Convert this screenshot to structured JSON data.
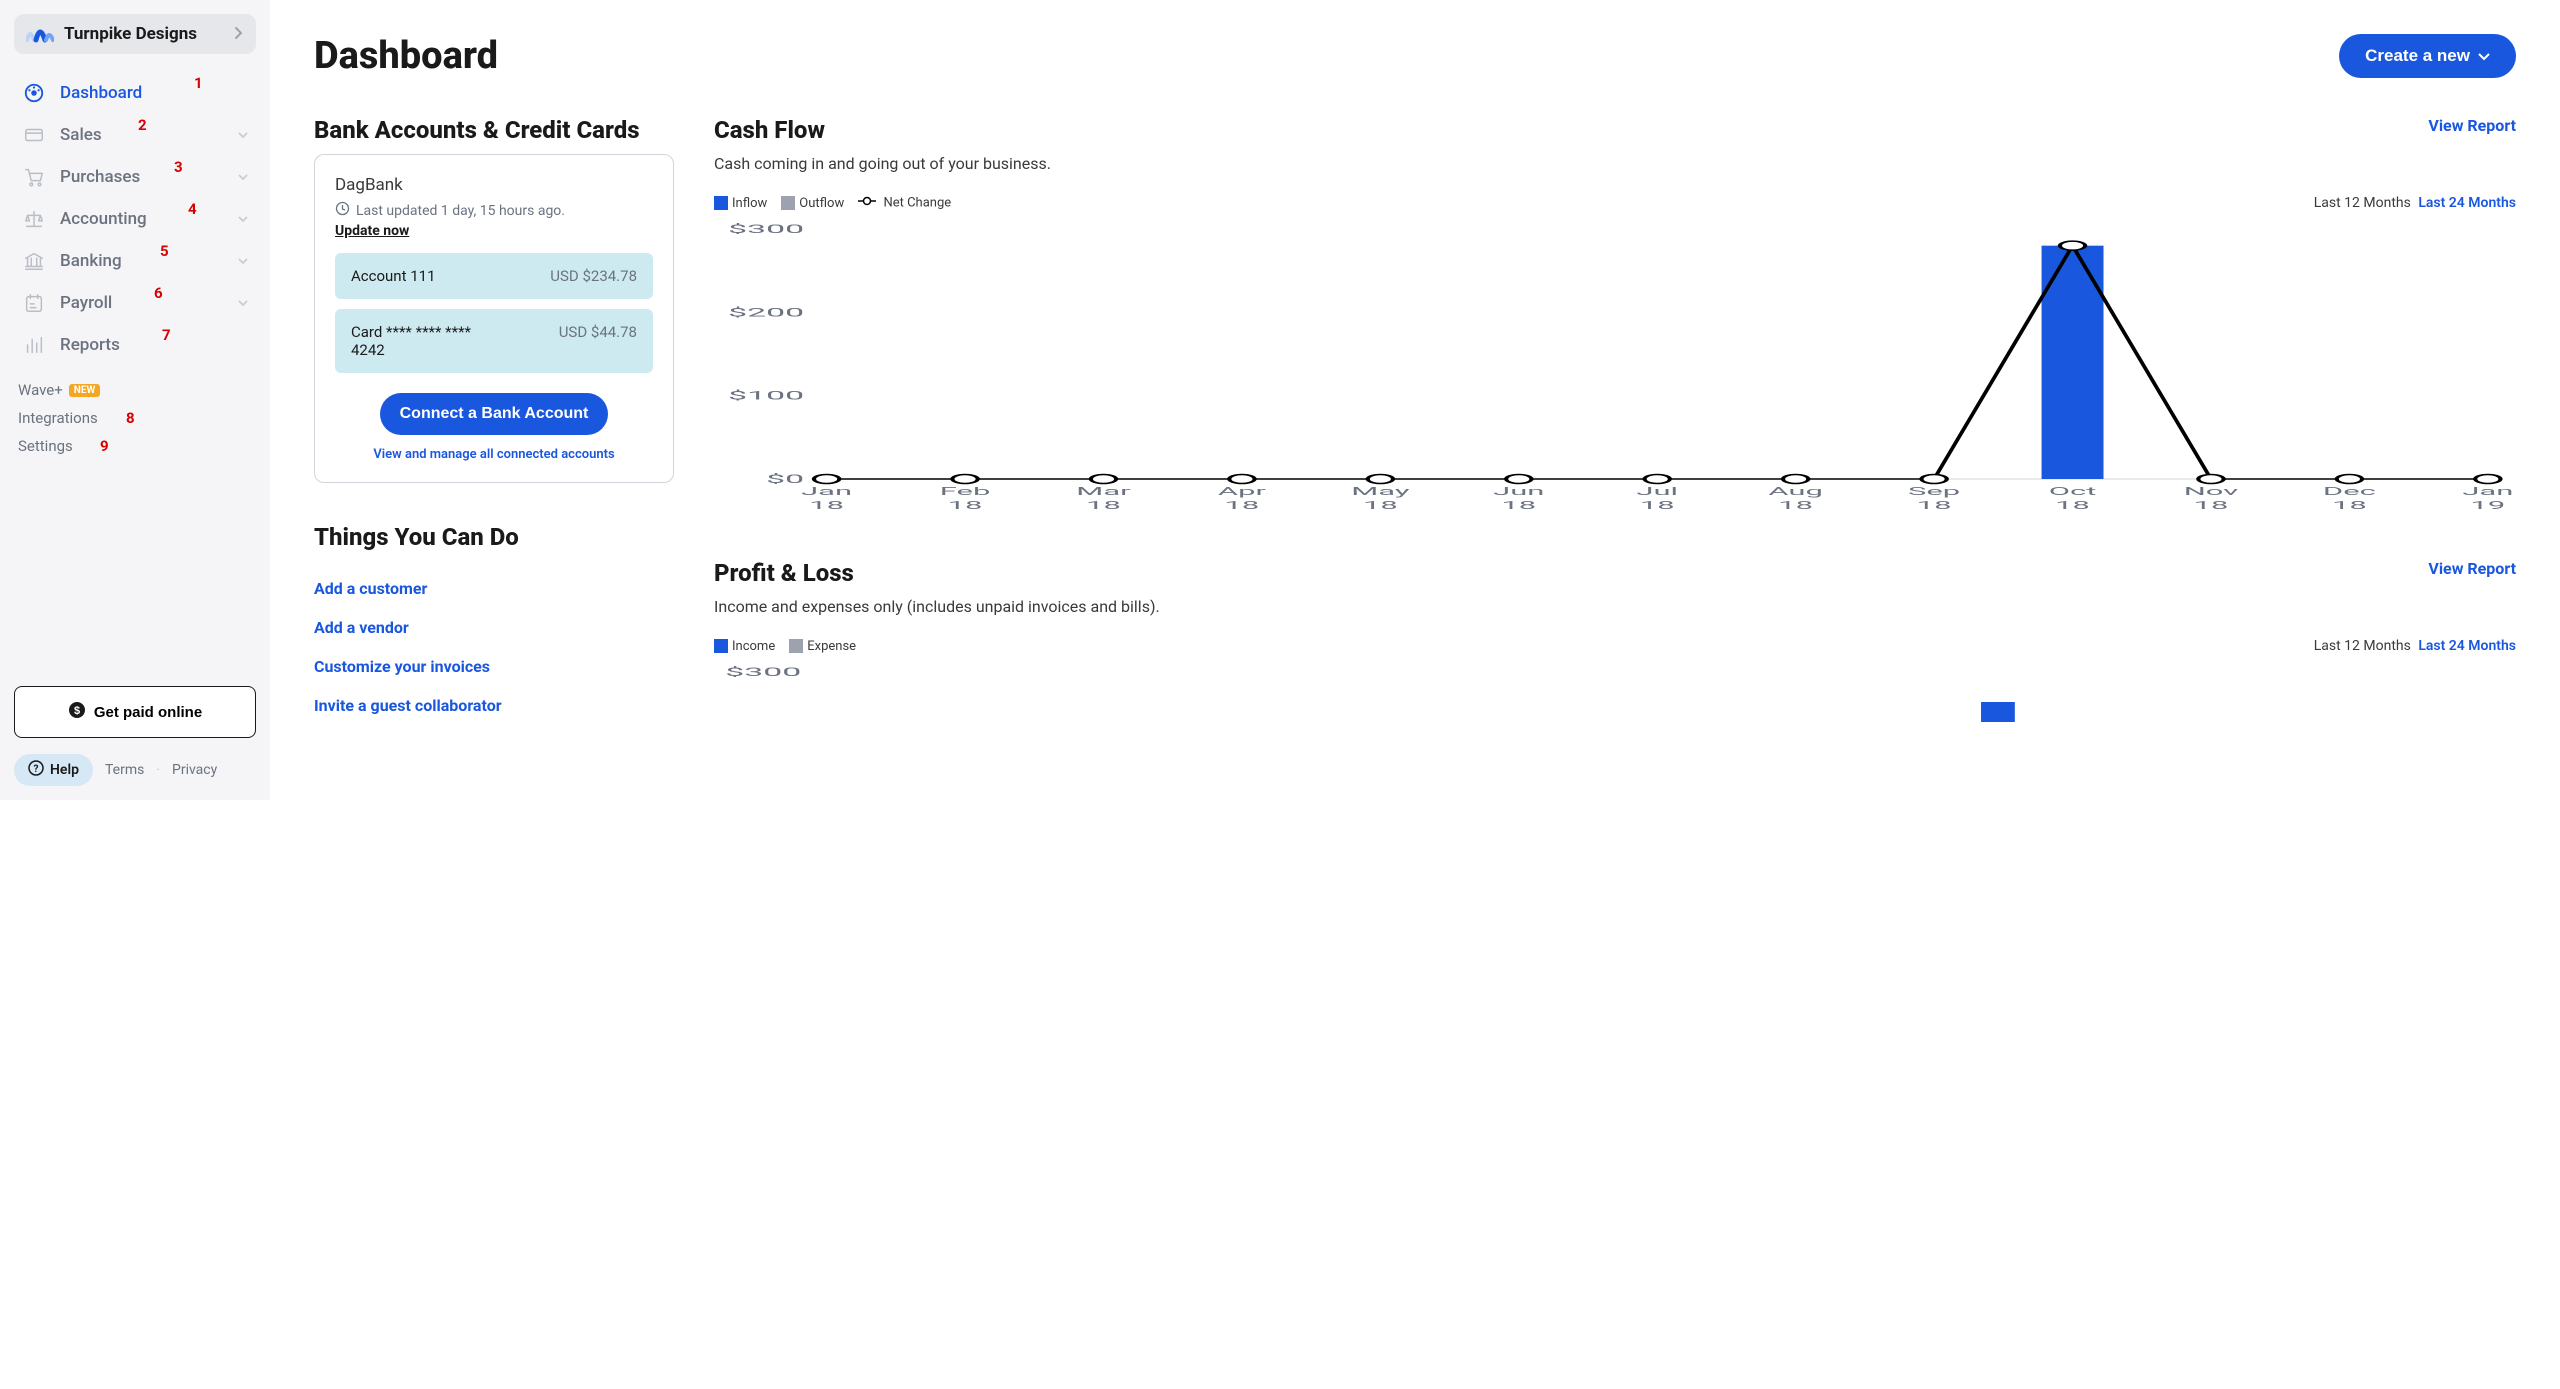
{
  "company": {
    "name": "Turnpike Designs"
  },
  "nav": [
    {
      "label": "Dashboard",
      "icon": "dashboard-icon",
      "active": true,
      "expandable": false,
      "num": "1",
      "numLeft": 180
    },
    {
      "label": "Sales",
      "icon": "card-icon",
      "active": false,
      "expandable": true,
      "num": "2",
      "numLeft": 124
    },
    {
      "label": "Purchases",
      "icon": "cart-icon",
      "active": false,
      "expandable": true,
      "num": "3",
      "numLeft": 160
    },
    {
      "label": "Accounting",
      "icon": "balance-icon",
      "active": false,
      "expandable": true,
      "num": "4",
      "numLeft": 174
    },
    {
      "label": "Banking",
      "icon": "bank-icon",
      "active": false,
      "expandable": true,
      "num": "5",
      "numLeft": 146
    },
    {
      "label": "Payroll",
      "icon": "payroll-icon",
      "active": false,
      "expandable": true,
      "num": "6",
      "numLeft": 140
    },
    {
      "label": "Reports",
      "icon": "reports-icon",
      "active": false,
      "expandable": false,
      "num": "7",
      "numLeft": 148
    }
  ],
  "sublinks": {
    "waveplus": {
      "label": "Wave+",
      "badge": "NEW"
    },
    "integrations": {
      "label": "Integrations",
      "num": "8",
      "numLeft": 108
    },
    "settings": {
      "label": "Settings",
      "num": "9",
      "numLeft": 82
    }
  },
  "footer": {
    "get_paid": "Get paid online",
    "help": "Help",
    "terms": "Terms",
    "privacy": "Privacy"
  },
  "header": {
    "title": "Dashboard",
    "create": "Create a new"
  },
  "bank": {
    "title": "Bank Accounts & Credit Cards",
    "bank_name": "DagBank",
    "updated": "Last updated 1 day, 15 hours ago.",
    "update_now": "Update now",
    "accounts": [
      {
        "label": "Account 111",
        "amount": "USD $234.78"
      },
      {
        "label": "Card **** **** **** 4242",
        "amount": "USD $44.78"
      }
    ],
    "connect": "Connect a Bank Account",
    "view_manage": "View and manage all connected accounts"
  },
  "things": {
    "title": "Things You Can Do",
    "links": [
      "Add a customer",
      "Add a vendor",
      "Customize your invoices",
      "Invite a guest collaborator"
    ]
  },
  "cashflow": {
    "title": "Cash Flow",
    "subtitle": "Cash coming in and going out of your business.",
    "view_report": "View Report",
    "legend": {
      "inflow": "Inflow",
      "outflow": "Outflow",
      "net": "Net Change"
    },
    "range": {
      "last12": "Last 12 Months",
      "last24": "Last 24 Months"
    }
  },
  "profitloss": {
    "title": "Profit & Loss",
    "subtitle": "Income and expenses only (includes unpaid invoices and bills).",
    "view_report": "View Report",
    "legend": {
      "income": "Income",
      "expense": "Expense"
    },
    "range": {
      "last12": "Last 12 Months",
      "last24": "Last 24 Months"
    }
  },
  "chart_data": {
    "type": "bar+line",
    "title": "Cash Flow",
    "ylabel": "",
    "ylim": [
      0,
      300
    ],
    "yticks": [
      0,
      100,
      200,
      300
    ],
    "categories": [
      "Jan 18",
      "Feb 18",
      "Mar 18",
      "Apr 18",
      "May 18",
      "Jun 18",
      "Jul 18",
      "Aug 18",
      "Sep 18",
      "Oct 18",
      "Nov 18",
      "Dec 18",
      "Jan 19"
    ],
    "series": [
      {
        "name": "Inflow",
        "type": "bar",
        "color": "#1957de",
        "values": [
          0,
          0,
          0,
          0,
          0,
          0,
          0,
          0,
          0,
          280,
          0,
          0,
          0
        ]
      },
      {
        "name": "Outflow",
        "type": "bar",
        "color": "#9ca3af",
        "values": [
          0,
          0,
          0,
          0,
          0,
          0,
          0,
          0,
          0,
          0,
          0,
          0,
          0
        ]
      },
      {
        "name": "Net Change",
        "type": "line",
        "color": "#000000",
        "values": [
          0,
          0,
          0,
          0,
          0,
          0,
          0,
          0,
          0,
          280,
          0,
          0,
          0
        ]
      }
    ]
  }
}
